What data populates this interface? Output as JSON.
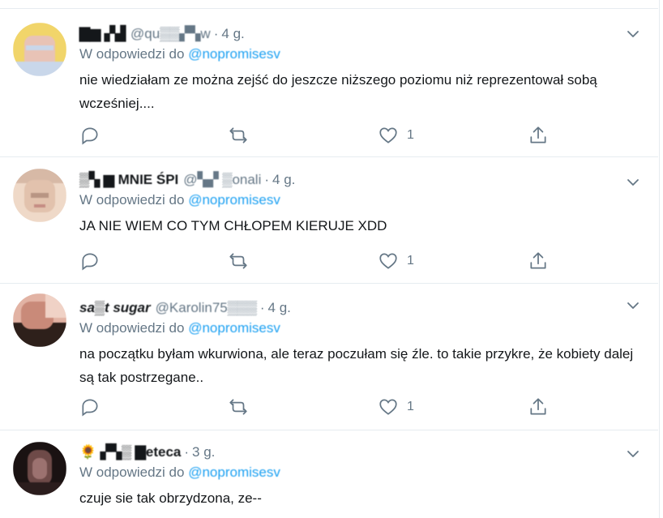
{
  "tweets": [
    {
      "name": "▇▆ ▞▟",
      "handle": "@qu▒▒▞▚w",
      "time": "4 g.",
      "reply_prefix": "W odpowiedzi do",
      "reply_to": "@nopromisesv",
      "text": "nie wiedziałam ze można zejść do jeszcze niższego poziomu niż reprezentował sobą wcześniej....",
      "reply_count": "",
      "retweet_count": "",
      "like_count": "1",
      "avatar_colors": [
        "#f1d56a",
        "#c9d7ea",
        "#e8c3b6"
      ]
    },
    {
      "name": "▒▚ ▆ MNIE ŚPI",
      "handle": "@▚▞ ▒onali",
      "time": "4 g.",
      "reply_prefix": "W odpowiedzi do",
      "reply_to": "@nopromisesv",
      "text": "JA NIE WIEM CO TYM CHŁOPEM KIERUJE XDD",
      "reply_count": "",
      "retweet_count": "",
      "like_count": "1",
      "avatar_colors": [
        "#d7b9a6",
        "#efd9c8",
        "#b89583"
      ]
    },
    {
      "name": "sa▒t sugar",
      "handle": "@Karolin75▒▒▒",
      "time": "4 g.",
      "reply_prefix": "W odpowiedzi do",
      "reply_to": "@nopromisesv",
      "text": "na początku byłam wkurwiona, ale teraz poczułam się źle. to takie przykre, że kobiety dalej są tak postrzegane..",
      "reply_count": "",
      "retweet_count": "",
      "like_count": "1",
      "avatar_colors": [
        "#c98a79",
        "#2e201b",
        "#e2b3a4"
      ]
    },
    {
      "name": "🌻 ▞▚▒ ▇eteca",
      "handle": "",
      "time": "3 g.",
      "reply_prefix": "W odpowiedzi do",
      "reply_to": "@nopromisesv",
      "text": "czuje sie tak obrzydzona, ze--",
      "reply_count": "",
      "retweet_count": "",
      "like_count": "",
      "avatar_colors": [
        "#2b1d1d",
        "#6e4a48",
        "#1a1212"
      ]
    }
  ],
  "icons": {
    "reply": "reply-icon",
    "retweet": "retweet-icon",
    "like": "heart-icon",
    "share": "share-icon",
    "more": "chevron-down-icon"
  },
  "colors": {
    "text": "#14171a",
    "secondary": "#657786",
    "mention": "#1da1f2",
    "divider": "#e6ecf0"
  }
}
